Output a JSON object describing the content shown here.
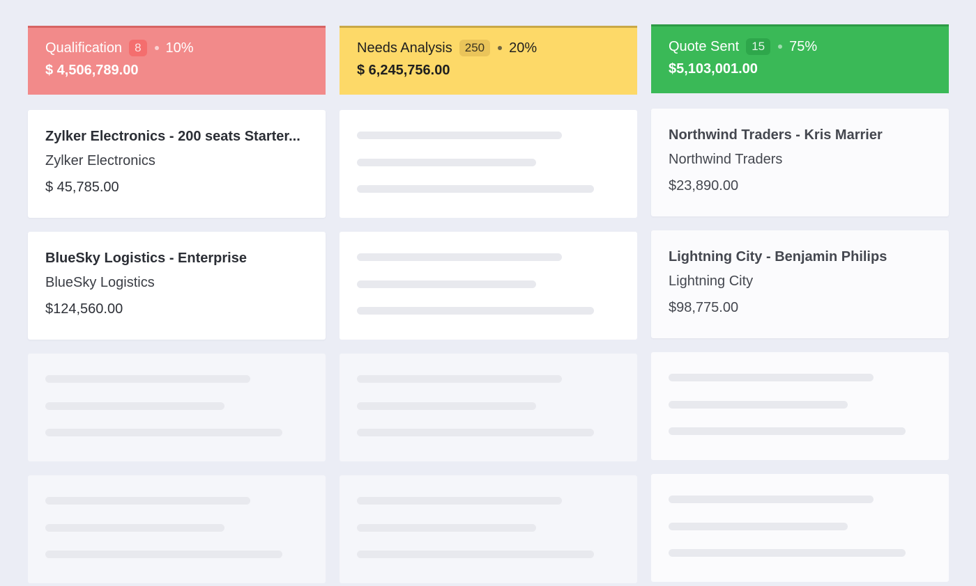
{
  "columns": [
    {
      "stage": "Qualification",
      "count": "8",
      "percent": "10%",
      "total": "$ 4,506,789.00",
      "colors": {
        "bg": "#f28a8a",
        "border": "#d66464",
        "text": "#ffffff",
        "badge_bg": "#f46e6e",
        "badge_text": "#fde3e3",
        "dot": "#fbd2d2"
      },
      "deals": [
        {
          "title": "Zylker Electronics - 200 seats Starter...",
          "account": "Zylker Electronics",
          "amount": "$ 45,785.00"
        },
        {
          "title": "BlueSky Logistics - Enterprise",
          "account": "BlueSky Logistics",
          "amount": "$124,560.00"
        }
      ],
      "placeholders": 2
    },
    {
      "stage": "Needs Analysis",
      "count": "250",
      "percent": "20%",
      "total": "$ 6,245,756.00",
      "colors": {
        "bg": "#fdd968",
        "border": "#c9a847",
        "text": "#1f1f1f",
        "badge_bg": "#eac45a",
        "badge_text": "#3a3320",
        "dot": "#6e6440"
      },
      "deals": [],
      "placeholders": 4
    },
    {
      "stage": "Quote Sent",
      "count": "15",
      "percent": "75%",
      "total": "$5,103,001.00",
      "colors": {
        "bg": "#3ab957",
        "border": "#2c9a45",
        "text": "#ffffff",
        "badge_bg": "#2ea74b",
        "badge_text": "#e4f6e8",
        "dot": "#9fdcae"
      },
      "deals": [
        {
          "title": "Northwind Traders - Kris Marrier",
          "account": "Northwind Traders",
          "amount": "$23,890.00"
        },
        {
          "title": "Lightning City - Benjamin Philips",
          "account": "Lightning City",
          "amount": "$98,775.00"
        }
      ],
      "placeholders": 2
    }
  ]
}
